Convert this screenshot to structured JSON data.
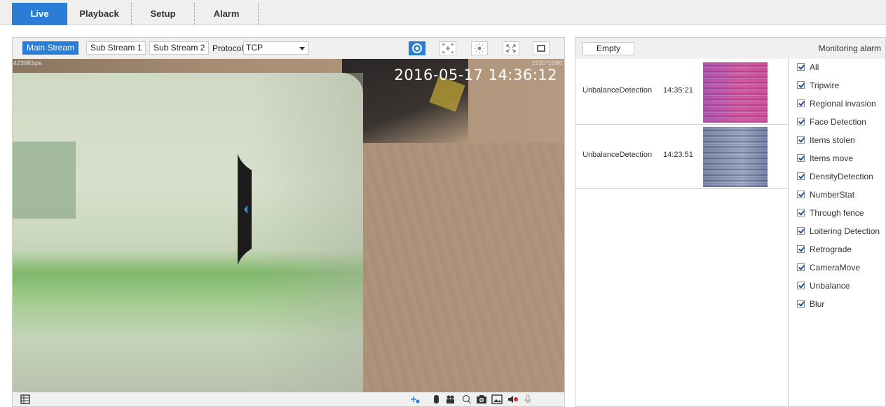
{
  "nav": {
    "tabs": [
      {
        "label": "Live",
        "active": true
      },
      {
        "label": "Playback",
        "active": false
      },
      {
        "label": "Setup",
        "active": false
      },
      {
        "label": "Alarm",
        "active": false
      }
    ]
  },
  "video_toolbar": {
    "streams": [
      "Main Stream",
      "Sub Stream 1",
      "Sub Stream 2"
    ],
    "active_stream": "Main Stream",
    "protocol_label": "Protocol",
    "protocol_value": "TCP",
    "tools": [
      "eye-icon",
      "zoom-region-icon",
      "brightness-icon",
      "fullscreen-icon",
      "window-icon"
    ]
  },
  "video": {
    "bitrate": "4239Kbps",
    "resolution": "1920*1080",
    "timestamp": "2016-05-17 14:36:12"
  },
  "bottom_bar": {
    "left_icon": "film-strip-icon",
    "right_icons": [
      "ptz-icon",
      "door-icon",
      "record-icon",
      "search-icon",
      "snapshot-icon",
      "image-icon",
      "audio-mute-icon",
      "microphone-icon"
    ]
  },
  "alarm_panel": {
    "empty_label": "Empty",
    "title": "Monitoring alarm",
    "events": [
      {
        "type": "UnbalanceDetection",
        "time": "14:35:21"
      },
      {
        "type": "UnbalanceDetection",
        "time": "14:23:51"
      }
    ],
    "filters": [
      {
        "label": "All",
        "checked": true
      },
      {
        "label": "Tripwire",
        "checked": true
      },
      {
        "label": "Regional invasion",
        "checked": true
      },
      {
        "label": "Face Detection",
        "checked": true
      },
      {
        "label": "Items stolen",
        "checked": true
      },
      {
        "label": "Items move",
        "checked": true
      },
      {
        "label": "DensityDetection",
        "checked": true
      },
      {
        "label": "NumberStat",
        "checked": true
      },
      {
        "label": "Through fence",
        "checked": true
      },
      {
        "label": "Loitering Detection",
        "checked": true
      },
      {
        "label": "Retrograde",
        "checked": true
      },
      {
        "label": "CameraMove",
        "checked": true
      },
      {
        "label": "Unbalance",
        "checked": true
      },
      {
        "label": "Blur",
        "checked": true
      }
    ]
  },
  "colors": {
    "accent": "#2a7dd4",
    "toolbar_bg": "#f0f0f0",
    "border": "#cfcfcf"
  }
}
